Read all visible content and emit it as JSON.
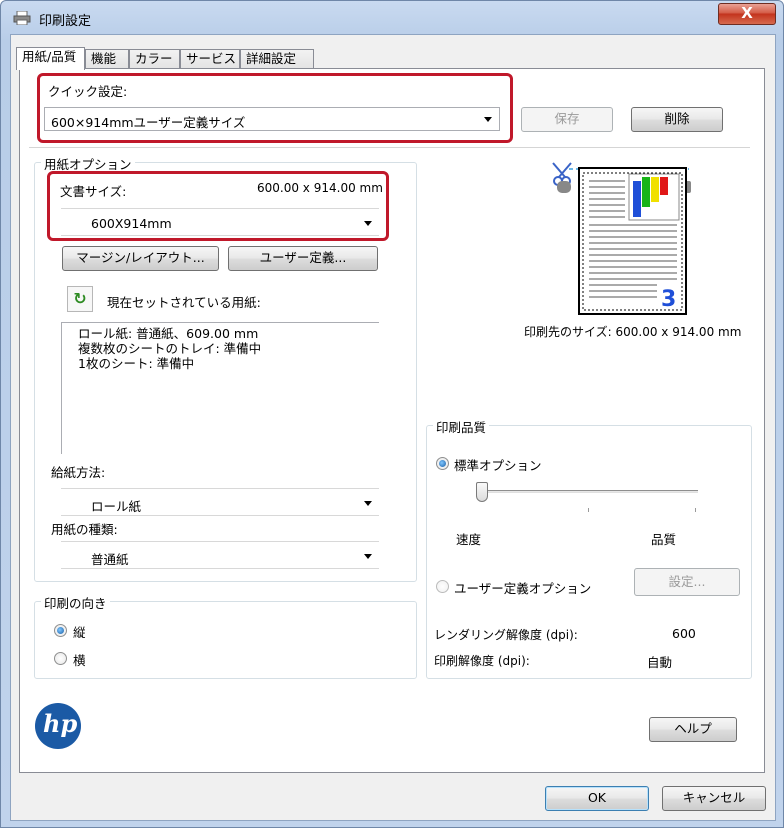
{
  "window": {
    "title": "印刷設定",
    "close_label": "X"
  },
  "tabs": [
    {
      "label": "用紙/品質",
      "active": true
    },
    {
      "label": "機能"
    },
    {
      "label": "カラー"
    },
    {
      "label": "サービス"
    },
    {
      "label": "詳細設定"
    }
  ],
  "quick": {
    "label": "クイック設定:",
    "value": "600×914mmユーザー定義サイズ",
    "save_label": "保存",
    "delete_label": "削除"
  },
  "paper_options": {
    "group_title": "用紙オプション",
    "doc_size_label": "文書サイズ:",
    "doc_size_value": "600.00 x 914.00 mm",
    "doc_size_select": "600X914mm",
    "margin_button": "マージン/レイアウト...",
    "custom_button": "ユーザー定義...",
    "current_label": "現在セットされている用紙:",
    "current_lines": [
      "ロール紙: 普通紙、609.00 mm",
      "複数枚のシートのトレイ: 準備中",
      "1枚のシート: 準備中"
    ],
    "feed_label": "給紙方法:",
    "feed_value": "ロール紙",
    "type_label": "用紙の種類:",
    "type_value": "普通紙"
  },
  "preview": {
    "output_size_label": "印刷先のサイズ: 600.00 x 914.00 mm",
    "page_number": "3",
    "colors": [
      "#1f4fd8",
      "#18b418",
      "#f0e000",
      "#e01818"
    ]
  },
  "orientation": {
    "group_title": "印刷の向き",
    "portrait": "縦",
    "landscape": "横"
  },
  "quality": {
    "group_title": "印刷品質",
    "standard_option": "標準オプション",
    "speed_label": "速度",
    "quality_label": "品質",
    "custom_option": "ユーザー定義オプション",
    "settings_button": "設定...",
    "rendering_label": "レンダリング解像度 (dpi):",
    "rendering_value": "600",
    "print_res_label": "印刷解像度 (dpi):",
    "print_res_value": "自動",
    "slider_position": 0
  },
  "logo_text": "hp",
  "help_button": "ヘルプ",
  "ok_button": "OK",
  "cancel_button": "キャンセル"
}
